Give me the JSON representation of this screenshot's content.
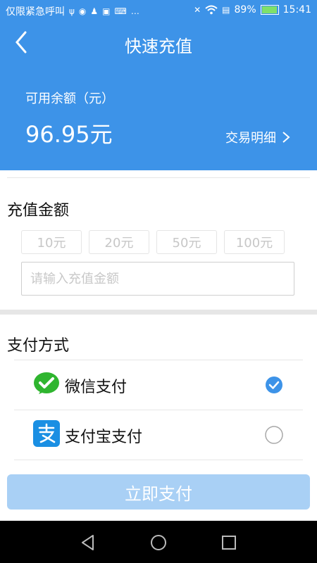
{
  "status_bar": {
    "carrier_text": "仅限紧急呼叫",
    "battery_percent": "89%",
    "battery_level": 0.89,
    "time": "15:41",
    "icons": [
      "usb-icon",
      "notification-badge-icon",
      "android-icon",
      "image-icon",
      "keyboard-icon",
      "more-icon",
      "mute-icon",
      "wifi-icon",
      "sim-icon",
      "battery-icon"
    ]
  },
  "header": {
    "title": "快速充值",
    "balance_label": "可用余额（元）",
    "balance_value": "96.95元",
    "detail_link": "交易明细",
    "color": "#3d93e8"
  },
  "recharge": {
    "section_title": "充值金额",
    "amounts": [
      "10元",
      "20元",
      "50元",
      "100元"
    ],
    "input_placeholder": "请输入充值金额",
    "input_value": ""
  },
  "payment": {
    "section_title": "支付方式",
    "methods": [
      {
        "label": "微信支付",
        "icon": "wechat-pay-icon",
        "selected": true
      },
      {
        "label": "支付宝支付",
        "icon": "alipay-icon",
        "selected": false
      }
    ]
  },
  "submit": {
    "label": "立即支付",
    "color": "#a9d0f5"
  },
  "nav_bar": {
    "buttons": [
      "back-nav-icon",
      "home-nav-icon",
      "recents-nav-icon"
    ]
  }
}
